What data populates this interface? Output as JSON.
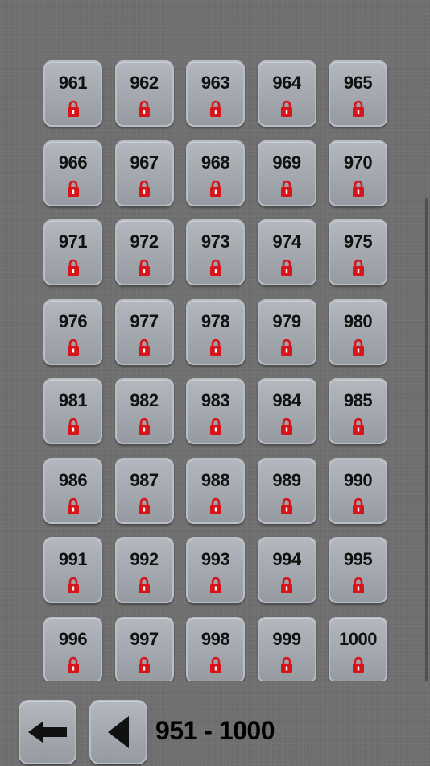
{
  "levels": {
    "items": [
      {
        "number": "961",
        "locked": true
      },
      {
        "number": "962",
        "locked": true
      },
      {
        "number": "963",
        "locked": true
      },
      {
        "number": "964",
        "locked": true
      },
      {
        "number": "965",
        "locked": true
      },
      {
        "number": "966",
        "locked": true
      },
      {
        "number": "967",
        "locked": true
      },
      {
        "number": "968",
        "locked": true
      },
      {
        "number": "969",
        "locked": true
      },
      {
        "number": "970",
        "locked": true
      },
      {
        "number": "971",
        "locked": true
      },
      {
        "number": "972",
        "locked": true
      },
      {
        "number": "973",
        "locked": true
      },
      {
        "number": "974",
        "locked": true
      },
      {
        "number": "975",
        "locked": true
      },
      {
        "number": "976",
        "locked": true
      },
      {
        "number": "977",
        "locked": true
      },
      {
        "number": "978",
        "locked": true
      },
      {
        "number": "979",
        "locked": true
      },
      {
        "number": "980",
        "locked": true
      },
      {
        "number": "981",
        "locked": true
      },
      {
        "number": "982",
        "locked": true
      },
      {
        "number": "983",
        "locked": true
      },
      {
        "number": "984",
        "locked": true
      },
      {
        "number": "985",
        "locked": true
      },
      {
        "number": "986",
        "locked": true
      },
      {
        "number": "987",
        "locked": true
      },
      {
        "number": "988",
        "locked": true
      },
      {
        "number": "989",
        "locked": true
      },
      {
        "number": "990",
        "locked": true
      },
      {
        "number": "991",
        "locked": true
      },
      {
        "number": "992",
        "locked": true
      },
      {
        "number": "993",
        "locked": true
      },
      {
        "number": "994",
        "locked": true
      },
      {
        "number": "995",
        "locked": true
      },
      {
        "number": "996",
        "locked": true
      },
      {
        "number": "997",
        "locked": true
      },
      {
        "number": "998",
        "locked": true
      },
      {
        "number": "999",
        "locked": true
      },
      {
        "number": "1000",
        "locked": true
      }
    ],
    "lock_icon": "padlock-icon",
    "lock_color": "#d8141b"
  },
  "footer": {
    "back_icon": "arrow-left-icon",
    "prev_icon": "triangle-left-icon",
    "range_label": "951 - 1000"
  },
  "colors": {
    "background": "#6e6e6e",
    "tile": "#a8acb3",
    "tile_border": "#b9bec6"
  }
}
